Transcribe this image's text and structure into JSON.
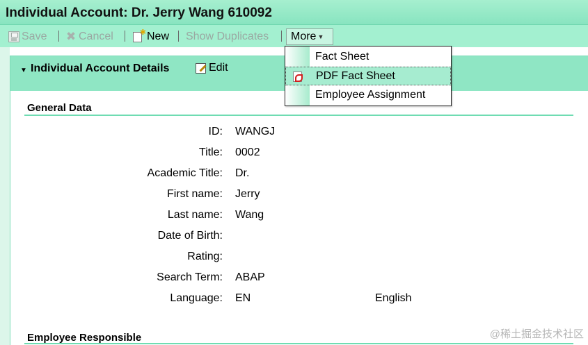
{
  "window": {
    "title": "Individual Account: Dr. Jerry Wang 610092"
  },
  "toolbar": {
    "save_label": "Save",
    "cancel_label": "Cancel",
    "new_label": "New",
    "show_duplicates_label": "Show Duplicates",
    "more_label": "More"
  },
  "more_menu": {
    "items": [
      {
        "label": "Fact Sheet",
        "icon": ""
      },
      {
        "label": "PDF Fact Sheet",
        "icon": "pdf-icon"
      },
      {
        "label": "Employee Assignment",
        "icon": ""
      }
    ]
  },
  "panel": {
    "title": "Individual Account Details",
    "edit_label": "Edit"
  },
  "general_data": {
    "title": "General Data",
    "fields": [
      {
        "label": "ID:",
        "value": "WANGJ"
      },
      {
        "label": "Title:",
        "value": "0002"
      },
      {
        "label": "Academic Title:",
        "value": "Dr."
      },
      {
        "label": "First name:",
        "value": "Jerry"
      },
      {
        "label": "Last name:",
        "value": "Wang"
      },
      {
        "label": "Date of Birth:",
        "value": ""
      },
      {
        "label": "Rating:",
        "value": ""
      },
      {
        "label": "Search Term:",
        "value": "ABAP"
      },
      {
        "label": "Language:",
        "value": "EN",
        "extra": "English"
      }
    ]
  },
  "employee_responsible": {
    "title": "Employee Responsible"
  },
  "watermark": "@稀土掘金技术社区",
  "colors": {
    "title_bar": "#a6efcf",
    "toolbar": "#a3f0d0",
    "panel_header": "#8fe6c4",
    "section_line": "#6fdcb2",
    "menu_hover": "#a6ecd0"
  }
}
